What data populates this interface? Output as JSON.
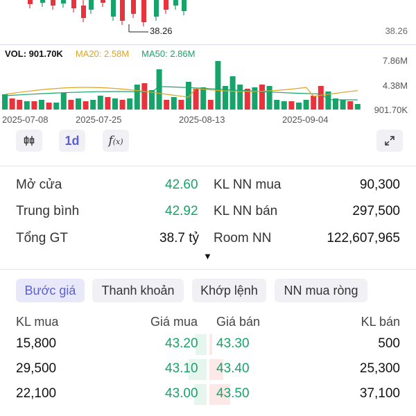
{
  "chart": {
    "price_label": "38.26",
    "low_annotation": "38.26",
    "volume_legend": {
      "vol": "VOL: 901.70K",
      "ma20": "MA20: 2.58M",
      "ma50": "MA50: 2.86M"
    },
    "volume_axis": [
      "7.86M",
      "4.38M",
      "901.70K"
    ],
    "dates": [
      "2025-07-08",
      "2025-07-25",
      "2025-08-13",
      "2025-09-04"
    ],
    "colors": {
      "up": "#18a36a",
      "down": "#e8333c",
      "ma20": "#e0a420",
      "ma50": "#18a36a"
    }
  },
  "toolbar": {
    "candle_icon": "candlestick-icon",
    "interval": "1d",
    "indicator_icon": "fx-icon",
    "fullscreen_icon": "expand-icon"
  },
  "stats": {
    "open_label": "Mở cửa",
    "open_value": "42.60",
    "avg_label": "Trung bình",
    "avg_value": "42.92",
    "total_label": "Tổng GT",
    "total_value": "38.7 tỷ",
    "foreign_buy_label": "KL NN mua",
    "foreign_buy_value": "90,300",
    "foreign_sell_label": "KL NN bán",
    "foreign_sell_value": "297,500",
    "room_label": "Room NN",
    "room_value": "122,607,965",
    "caret": "▼"
  },
  "tabs": [
    "Bước giá",
    "Thanh khoản",
    "Khớp lệnh",
    "NN mua ròng"
  ],
  "orderbook": {
    "headers": {
      "bid_vol": "KL mua",
      "bid_price": "Giá mua",
      "ask_price": "Giá bán",
      "ask_vol": "KL bán"
    },
    "rows": [
      {
        "bid_vol": "15,800",
        "bid_price": "43.20",
        "ask_price": "43.30",
        "ask_vol": "500"
      },
      {
        "bid_vol": "29,500",
        "bid_price": "43.10",
        "ask_price": "43.40",
        "ask_vol": "25,300"
      },
      {
        "bid_vol": "22,100",
        "bid_price": "43.00",
        "ask_price": "43.50",
        "ask_vol": "37,100"
      }
    ]
  }
}
